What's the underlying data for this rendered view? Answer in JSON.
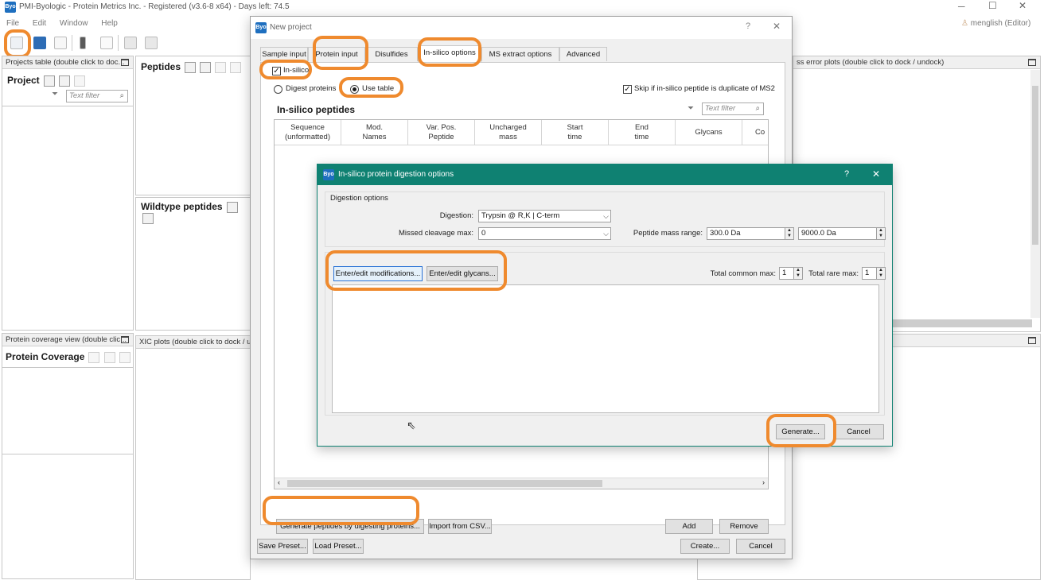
{
  "window": {
    "title": "PMI-Byologic - Protein Metrics Inc. - Registered (v3.6-8 x64) - Days left: 74.5",
    "user": "menglish (Editor)",
    "app_icon_text": "Byo"
  },
  "menu": [
    "File",
    "Edit",
    "Window",
    "Help"
  ],
  "panels": {
    "projects_title": "Projects table (double click to doc...",
    "project_label": "Project",
    "text_filter": "Text filter",
    "peptides_label": "Peptides",
    "wildtype_label": "Wildtype peptides",
    "coverage_title": "Protein coverage view (double clic...",
    "coverage_label": "Protein Coverage",
    "xic_title": "XIC plots (double click to dock / und",
    "mass_error_title": "ss error plots (double click to dock / undock)"
  },
  "new_project": {
    "title": "New project",
    "help": "?",
    "close": "✕",
    "tabs": [
      "Sample input",
      "Protein input",
      "Disulfides",
      "In-silico options",
      "MS extract options",
      "Advanced"
    ],
    "insilico_checkbox": "In-silico",
    "radio_digest": "Digest proteins",
    "radio_use_table": "Use table",
    "skip_label": "Skip if in-silico peptide is duplicate of MS2",
    "section_title": "In-silico peptides",
    "text_filter": "Text filter",
    "columns": [
      "Sequence\n(unformatted)",
      "Mod.\nNames",
      "Var. Pos.\nPeptide",
      "Uncharged\nmass",
      "Start\ntime",
      "End\ntime",
      "Glycans",
      "Co"
    ],
    "generate_btn": "Generate peptides by digesting proteins...",
    "import_btn": "Import from CSV...",
    "add_btn": "Add",
    "remove_btn": "Remove",
    "save_preset": "Save Preset...",
    "load_preset": "Load Preset...",
    "create_btn": "Create...",
    "cancel_btn": "Cancel"
  },
  "digestion": {
    "title": "In-silico protein digestion options",
    "help": "?",
    "close": "✕",
    "group_title": "Digestion options",
    "digestion_label": "Digestion:",
    "digestion_value": "Trypsin @ R,K | C-term",
    "missed_label": "Missed cleavage max:",
    "missed_value": "0",
    "mass_range_label": "Peptide mass range:",
    "mass_min": "300.0 Da",
    "mass_max": "9000.0 Da",
    "mods_btn": "Enter/edit modifications...",
    "glycans_btn": "Enter/edit glycans...",
    "common_label": "Total common max:",
    "common_value": "1",
    "rare_label": "Total rare max:",
    "rare_value": "1",
    "generate_btn": "Generate...",
    "cancel_btn": "Cancel"
  },
  "colors": {
    "highlight": "#ef8a2e",
    "digest_titlebar": "#0f8172",
    "selection": "#2b73d6"
  }
}
